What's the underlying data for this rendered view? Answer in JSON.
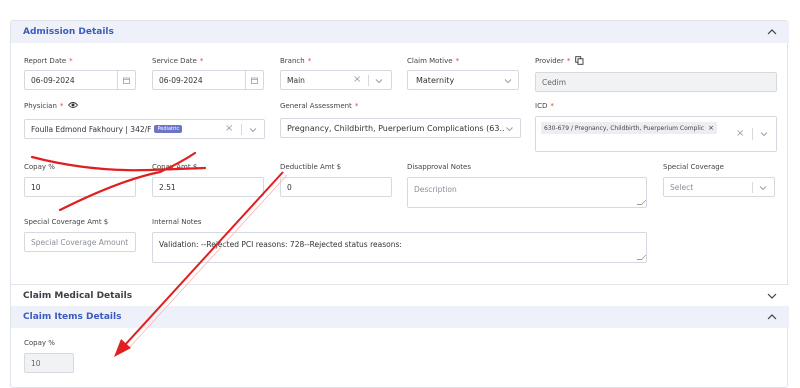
{
  "sections": {
    "admission": {
      "title": "Admission Details"
    },
    "medical": {
      "title": "Claim Medical Details"
    },
    "items": {
      "title": "Claim Items Details"
    }
  },
  "fields": {
    "report_date": {
      "label": "Report Date",
      "value": "06-09-2024"
    },
    "service_date": {
      "label": "Service Date",
      "value": "06-09-2024"
    },
    "branch": {
      "label": "Branch",
      "value": "Main"
    },
    "claim_motive": {
      "label": "Claim Motive",
      "value": "Maternity"
    },
    "provider": {
      "label": "Provider",
      "value": "Cedim"
    },
    "physician": {
      "label": "Physician",
      "value": "Foulla Edmond Fakhoury | 342/F",
      "badge": "Pediatric"
    },
    "general_assessment": {
      "label": "General Assessment",
      "value": "Pregnancy, Childbirth, Puerperium Complications (63..."
    },
    "icd": {
      "label": "ICD",
      "chip": "630-679 / Pregnancy, Childbirth, Puerperium Complic"
    },
    "copay_pct": {
      "label": "Copay %",
      "value": "10"
    },
    "copay_amt": {
      "label": "Copay Amt $",
      "value": "2.51"
    },
    "deductible_amt": {
      "label": "Deductible Amt $",
      "value": "0"
    },
    "disapproval_notes": {
      "label": "Disapproval Notes",
      "placeholder": "Description"
    },
    "special_coverage": {
      "label": "Special Coverage",
      "placeholder": "Select"
    },
    "special_coverage_amt": {
      "label": "Special Coverage Amt $",
      "placeholder": "Special Coverage Amount"
    },
    "internal_notes": {
      "label": "Internal Notes",
      "value": "Validation: --Rejected PCI reasons: 728--Rejected status reasons:"
    },
    "items_copay_pct": {
      "label": "Copay %",
      "value": "10"
    }
  },
  "required_mark": "*",
  "clear_glyph": "×",
  "colors": {
    "accent": "#3b5bbf",
    "section_bg": "#eef1f9",
    "required": "#e0413b",
    "annotation": "#e02020"
  }
}
